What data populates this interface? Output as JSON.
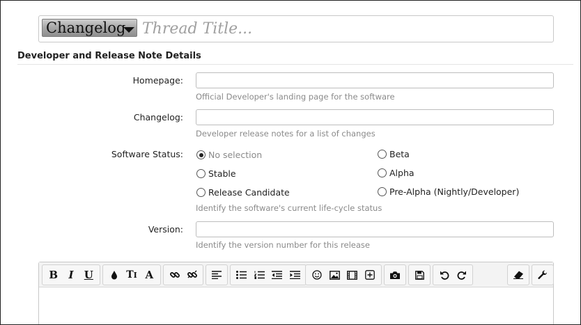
{
  "title_bar": {
    "prefix_label": "Changelog",
    "title_placeholder": "Thread Title..."
  },
  "section": {
    "title": "Developer and Release Note Details"
  },
  "fields": {
    "homepage": {
      "label": "Homepage:",
      "value": "",
      "hint": "Official Developer's landing page for the software"
    },
    "changelog": {
      "label": "Changelog:",
      "value": "",
      "hint": "Developer release notes for a list of changes"
    },
    "software_status": {
      "label": "Software Status:",
      "selected": "No selection",
      "options": [
        "No selection",
        "Beta",
        "Stable",
        "Alpha",
        "Release Candidate",
        "Pre-Alpha (Nightly/Developer)"
      ],
      "hint": "Identify the software's current life-cycle status"
    },
    "version": {
      "label": "Version:",
      "value": "",
      "hint": "Identify the version number for this release"
    }
  },
  "editor": {
    "toolbar_icons": [
      "bold-icon",
      "italic-icon",
      "underline-icon",
      "text-color-icon",
      "font-size-icon",
      "font-family-icon",
      "link-icon",
      "unlink-icon",
      "align-left-icon",
      "bullet-list-icon",
      "numbered-list-icon",
      "outdent-icon",
      "indent-icon",
      "smilie-icon",
      "image-icon",
      "media-icon",
      "insert-icon",
      "screenshot-icon",
      "save-draft-icon",
      "undo-icon",
      "redo-icon",
      "remove-formatting-icon",
      "toggle-bbcode-icon"
    ],
    "content": ""
  }
}
